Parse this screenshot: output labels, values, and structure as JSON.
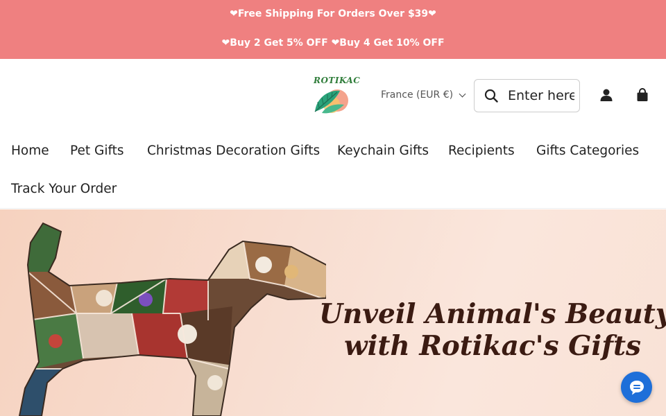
{
  "announcement": {
    "line1": "❤Free Shipping For Orders Over $39❤",
    "line2": "❤Buy 2 Get 5% OFF ❤Buy 4 Get 10% OFF"
  },
  "header": {
    "logo_text": "ROTIKAC",
    "currency": "France (EUR €)",
    "search_placeholder": "Enter here",
    "icons": {
      "search": "search-icon",
      "account": "user-icon",
      "cart": "shopping-bag-icon"
    }
  },
  "nav": {
    "items": [
      {
        "label": "Home"
      },
      {
        "label": "Pet Gifts"
      },
      {
        "label": "Christmas Decoration Gifts"
      },
      {
        "label": "Keychain Gifts"
      },
      {
        "label": "Recipients"
      },
      {
        "label": "Gifts Categories"
      },
      {
        "label": "Track Your Order"
      }
    ]
  },
  "hero": {
    "line1": "Unveil Animal's Beauty",
    "line2": "with Rotikac's Gifts"
  },
  "colors": {
    "announcement_bg": "#ef8080",
    "hero_bg": "#f8ddd0",
    "hero_text": "#3b1b12",
    "chat_button": "#1e6fd9"
  }
}
